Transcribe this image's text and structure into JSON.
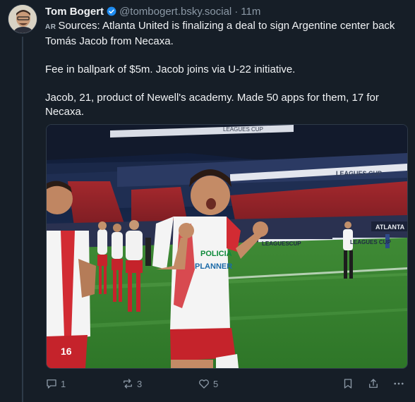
{
  "post": {
    "author_name": "Tom Bogert",
    "handle": "@tombogert.bsky.social",
    "separator": "·",
    "time": "11m",
    "lang_tag": "AR",
    "paragraphs": [
      "Sources: Atlanta United is finalizing a deal to sign Argentine center back Tomás Jacob from Necaxa.",
      "Fee in ballpark of $5m. Jacob joins via U-22 initiative.",
      "Jacob, 21, product of Newell's academy. Made 50 apps for them, 17 for Necaxa."
    ]
  },
  "image": {
    "banner_text_1": "LEAGUES CUP",
    "banner_text_2": "LEAGUES CUP",
    "board_text_1": "LEAGUESCUP",
    "board_text_2": "LEAGUES CUP",
    "board_text_atlanta": "ATLANTA",
    "jersey_sponsor": "POLICIA",
    "jersey_sponsor_2": "PLANNER",
    "left_player_number": "16"
  },
  "actions": {
    "reply_count": "1",
    "repost_count": "3",
    "like_count": "5"
  },
  "icons": {
    "verified": "verified-badge-icon",
    "reply": "comment-icon",
    "repost": "repost-icon",
    "like": "heart-icon",
    "bookmark": "bookmark-icon",
    "share": "share-icon",
    "more": "more-icon"
  },
  "colors": {
    "background": "#161e27",
    "verified": "#1d8bf0",
    "muted": "#8b98a5",
    "text": "#f1f3f5"
  }
}
